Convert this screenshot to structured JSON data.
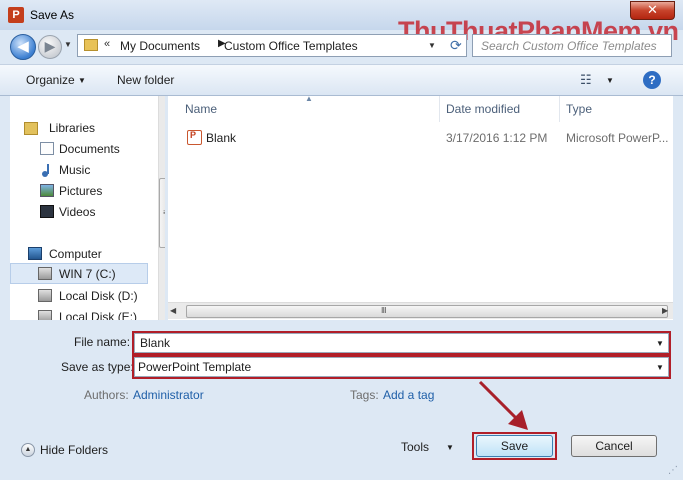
{
  "window": {
    "title": "Save As",
    "app_icon_letter": "P",
    "close_symbol": "✕"
  },
  "watermark": "ThuThuatPhanMem.vn",
  "navigation": {
    "back_symbol": "◀",
    "forward_symbol": "▶",
    "dropdown_symbol": "▼",
    "overflow_symbol": "«",
    "breadcrumb": [
      "My Documents",
      "Custom Office Templates"
    ],
    "separator_symbol": "▶",
    "refresh_symbol": "⟳",
    "search_placeholder": "Search Custom Office Templates"
  },
  "toolbar": {
    "organize_label": "Organize",
    "new_folder_label": "New folder",
    "views_symbol": "☷",
    "help_symbol": "?"
  },
  "nav_pane": {
    "items": [
      {
        "label": "Libraries",
        "icon": "libraries-icon"
      },
      {
        "label": "Documents",
        "icon": "documents-icon"
      },
      {
        "label": "Music",
        "icon": "music-icon"
      },
      {
        "label": "Pictures",
        "icon": "pictures-icon"
      },
      {
        "label": "Videos",
        "icon": "videos-icon"
      },
      {
        "label": "Computer",
        "icon": "computer-icon"
      },
      {
        "label": "WIN 7 (C:)",
        "icon": "drive-icon",
        "selected": true
      },
      {
        "label": "Local Disk (D:)",
        "icon": "drive-icon"
      },
      {
        "label": "Local Disk (E:)",
        "icon": "drive-icon"
      }
    ],
    "scroll_grip": "≡"
  },
  "file_list": {
    "columns": {
      "name": "Name",
      "date": "Date modified",
      "type": "Type"
    },
    "sort_symbol": "▲",
    "rows": [
      {
        "name": "Blank",
        "date": "3/17/2016 1:12 PM",
        "type": "Microsoft PowerP..."
      }
    ],
    "scroll_grip": "Ⅲ"
  },
  "form": {
    "file_name_label": "File name:",
    "file_name_value": "Blank",
    "save_type_label": "Save as type:",
    "save_type_value": "PowerPoint Template",
    "authors_label": "Authors:",
    "authors_value": "Administrator",
    "tags_label": "Tags:",
    "tags_value": "Add a tag"
  },
  "footer": {
    "hide_folders_label": "Hide Folders",
    "tools_label": "Tools",
    "save_label": "Save",
    "cancel_label": "Cancel"
  },
  "colors": {
    "highlight": "#b11e28",
    "link": "#1f5fa8"
  }
}
